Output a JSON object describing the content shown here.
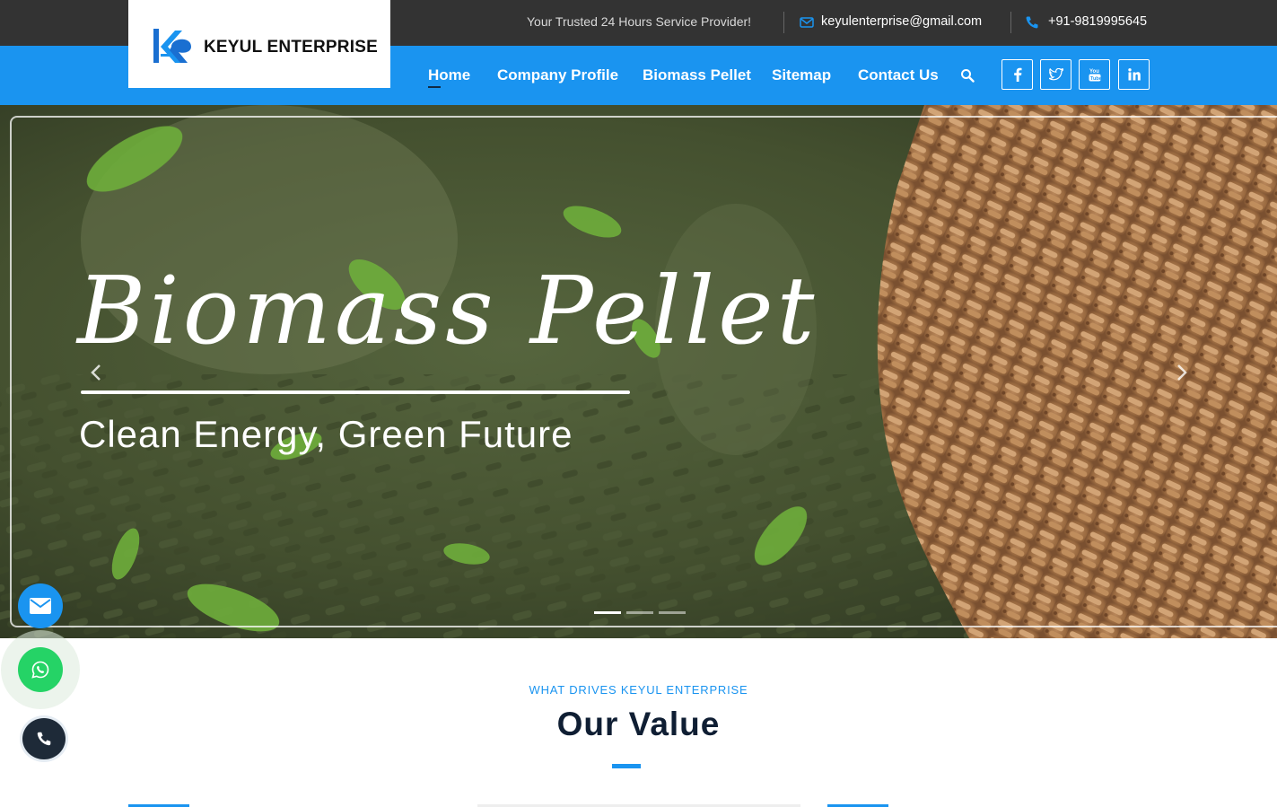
{
  "topbar": {
    "tagline": "Your Trusted 24 Hours Service Provider!",
    "email": "keyulenterprise@gmail.com",
    "phone": "+91-9819995645",
    "email_icon": "envelope-icon",
    "phone_icon": "phone-icon"
  },
  "brand": {
    "name": "KEYUL ENTERPRISE",
    "logo_icon": "ke-logo-mark"
  },
  "nav": {
    "items": [
      {
        "label": "Home",
        "active": true
      },
      {
        "label": "Company Profile",
        "active": false
      },
      {
        "label": "Biomass Pellet",
        "active": false
      },
      {
        "label": "Sitemap",
        "active": false
      },
      {
        "label": "Contact Us",
        "active": false
      }
    ],
    "search_icon": "search-icon",
    "social": [
      "facebook-icon",
      "twitter-icon",
      "youtube-icon",
      "linkedin-icon"
    ]
  },
  "hero": {
    "title": "Biomass Pellet",
    "subtitle": "Clean Energy, Green Future",
    "slides": 3,
    "active_slide": 1
  },
  "floating": {
    "mail_icon": "envelope-icon",
    "whatsapp_icon": "whatsapp-icon",
    "call_icon": "phone-icon"
  },
  "section": {
    "kicker": "WHAT DRIVES KEYUL ENTERPRISE",
    "title": "Our Value"
  },
  "colors": {
    "topbar": "#333333",
    "primary": "#1a94f0",
    "dark": "#0f1e33",
    "whatsapp": "#25d366"
  }
}
